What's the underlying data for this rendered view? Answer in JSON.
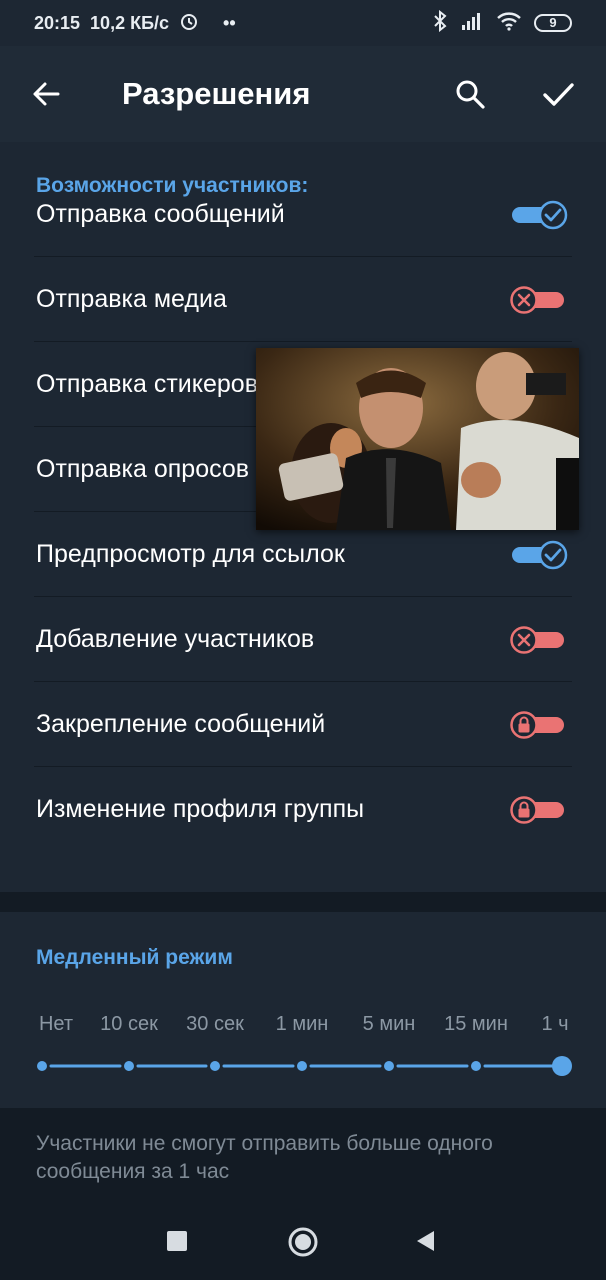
{
  "status_bar": {
    "time": "20:15",
    "speed": "10,2 КБ/с",
    "dots": "••",
    "battery": "9"
  },
  "app_bar": {
    "title": "Разрешения",
    "back_icon": "arrow-left-icon",
    "search_icon": "search-icon",
    "confirm_icon": "check-icon"
  },
  "permissions": {
    "header": "Возможности участников:",
    "items": [
      {
        "label": "Отправка сообщений",
        "state": "on"
      },
      {
        "label": "Отправка медиа",
        "state": "off"
      },
      {
        "label": "Отправка стикеров",
        "state": "off"
      },
      {
        "label": "Отправка опросов",
        "state": "off"
      },
      {
        "label": "Предпросмотр для ссылок",
        "state": "on"
      },
      {
        "label": "Добавление участников",
        "state": "off"
      },
      {
        "label": "Закрепление сообщений",
        "state": "locked"
      },
      {
        "label": "Изменение профиля группы",
        "state": "locked"
      }
    ]
  },
  "slow_mode": {
    "header": "Медленный режим",
    "options": [
      "Нет",
      "10 сек",
      "30 сек",
      "1 мин",
      "5 мин",
      "15 мин",
      "1 ч"
    ],
    "selected_index": 6
  },
  "footer": {
    "text": "Участники не смогут отправить больше одного сообщения за 1 час"
  },
  "colors": {
    "accent": "#5aa5e8",
    "danger": "#ea7373",
    "background": "#1d2733"
  }
}
